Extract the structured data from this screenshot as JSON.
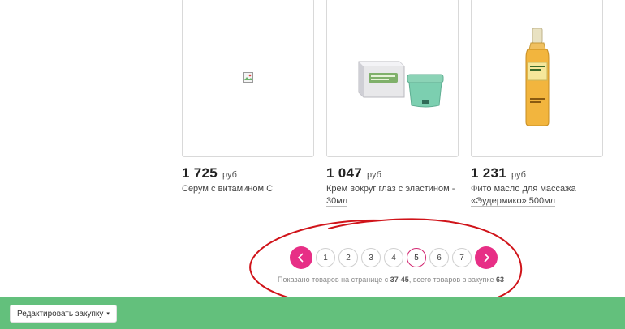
{
  "products": [
    {
      "price": "1 725",
      "currency": "руб",
      "name_line1": "Серум с витамином С",
      "name_line2": ""
    },
    {
      "price": "1 047",
      "currency": "руб",
      "name_line1": "Крем вокруг глаз с эластином -",
      "name_line2": "30мл"
    },
    {
      "price": "1 231",
      "currency": "руб",
      "name_line1": "Фито масло для массажа",
      "name_line2": "«Эудермико» 500мл"
    }
  ],
  "pagination": {
    "prev_icon": "chevron-left-icon",
    "next_icon": "chevron-right-icon",
    "pages": [
      "1",
      "2",
      "3",
      "4",
      "5",
      "6",
      "7"
    ],
    "current_page": "5",
    "accent": "#e72f86"
  },
  "summary": {
    "prefix": "Показано товаров на странице с ",
    "range": "37-45",
    "middle": ", всего товаров в закупке ",
    "total": "63"
  },
  "bottom_bar": {
    "color": "#63c07c",
    "edit_label": "Редактировать закупку",
    "caret": "▾"
  },
  "annotation_color": "#d0141a"
}
